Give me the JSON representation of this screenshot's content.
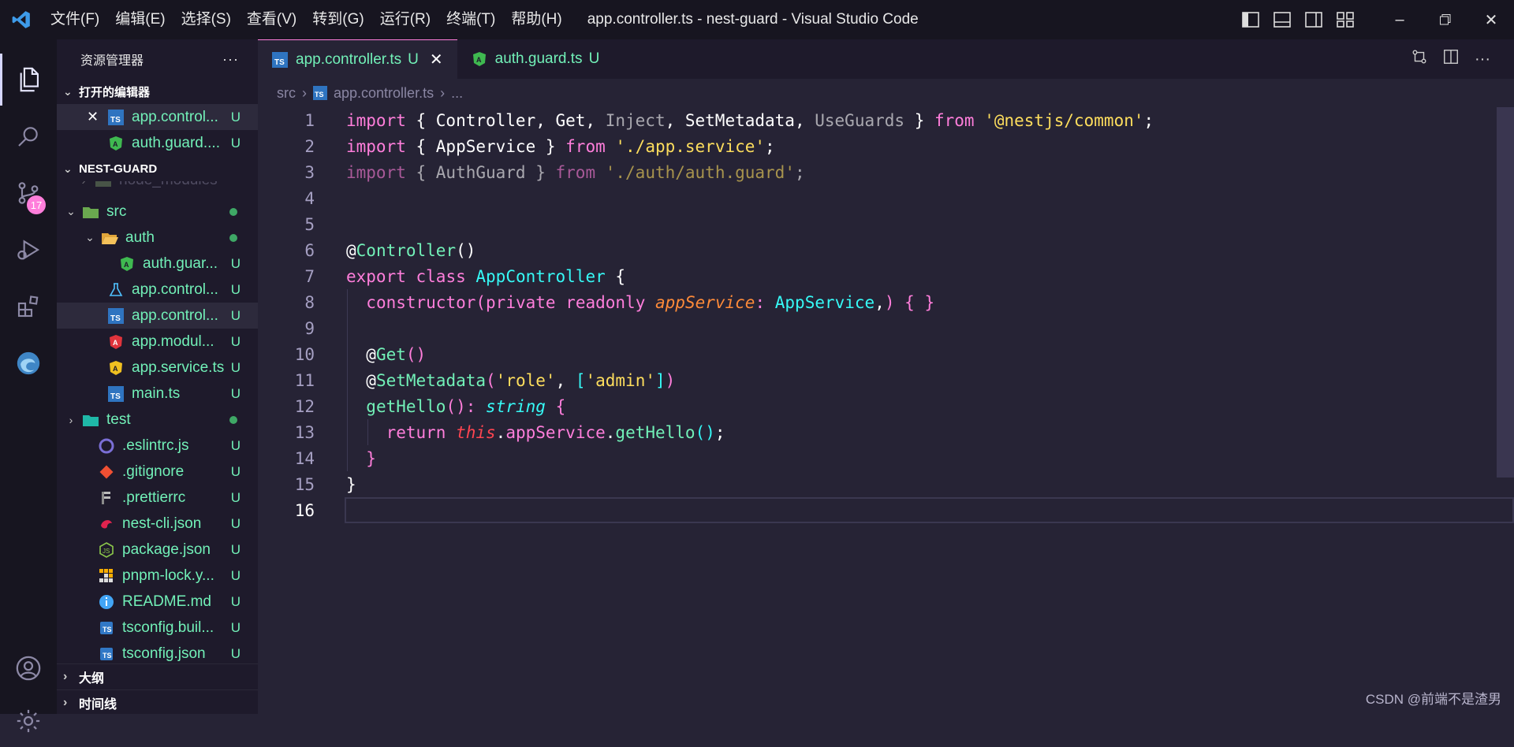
{
  "window": {
    "title": "app.controller.ts - nest-guard - Visual Studio Code",
    "menu": [
      "文件(F)",
      "编辑(E)",
      "选择(S)",
      "查看(V)",
      "转到(G)",
      "运行(R)",
      "终端(T)",
      "帮助(H)"
    ]
  },
  "activity": {
    "scm_badge": "17"
  },
  "sidebar": {
    "title": "资源管理器",
    "more": "···",
    "open_editors": {
      "label": "打开的编辑器",
      "items": [
        {
          "name": "app.control...",
          "status": "U"
        },
        {
          "name": "auth.guard....",
          "status": "U"
        }
      ]
    },
    "project": {
      "label": "NEST-GUARD",
      "items": [
        {
          "name": "node_modules",
          "status": ""
        },
        {
          "name": "src",
          "status": ""
        },
        {
          "name": "auth",
          "status": ""
        },
        {
          "name": "auth.guar...",
          "status": "U"
        },
        {
          "name": "app.control...",
          "status": "U"
        },
        {
          "name": "app.control...",
          "status": "U"
        },
        {
          "name": "app.modul...",
          "status": "U"
        },
        {
          "name": "app.service.ts",
          "status": "U"
        },
        {
          "name": "main.ts",
          "status": "U"
        },
        {
          "name": "test",
          "status": ""
        },
        {
          "name": ".eslintrc.js",
          "status": "U"
        },
        {
          "name": ".gitignore",
          "status": "U"
        },
        {
          "name": ".prettierrc",
          "status": "U"
        },
        {
          "name": "nest-cli.json",
          "status": "U"
        },
        {
          "name": "package.json",
          "status": "U"
        },
        {
          "name": "pnpm-lock.y...",
          "status": "U"
        },
        {
          "name": "README.md",
          "status": "U"
        },
        {
          "name": "tsconfig.buil...",
          "status": "U"
        },
        {
          "name": "tsconfig.json",
          "status": "U"
        }
      ]
    },
    "outline": "大纲",
    "timeline": "时间线"
  },
  "tabs": [
    {
      "label": "app.controller.ts",
      "status": "U"
    },
    {
      "label": "auth.guard.ts",
      "status": "U"
    }
  ],
  "breadcrumb": {
    "folder": "src",
    "file": "app.controller.ts",
    "more": "..."
  },
  "editor": {
    "line_numbers": [
      "1",
      "2",
      "3",
      "4",
      "5",
      "6",
      "7",
      "8",
      "9",
      "10",
      "11",
      "12",
      "13",
      "14",
      "15",
      "16"
    ]
  },
  "watermark": "CSDN @前端不是渣男",
  "colors": {
    "accent": "#ff7edb",
    "green": "#72f1b8",
    "bg": "#262335"
  }
}
